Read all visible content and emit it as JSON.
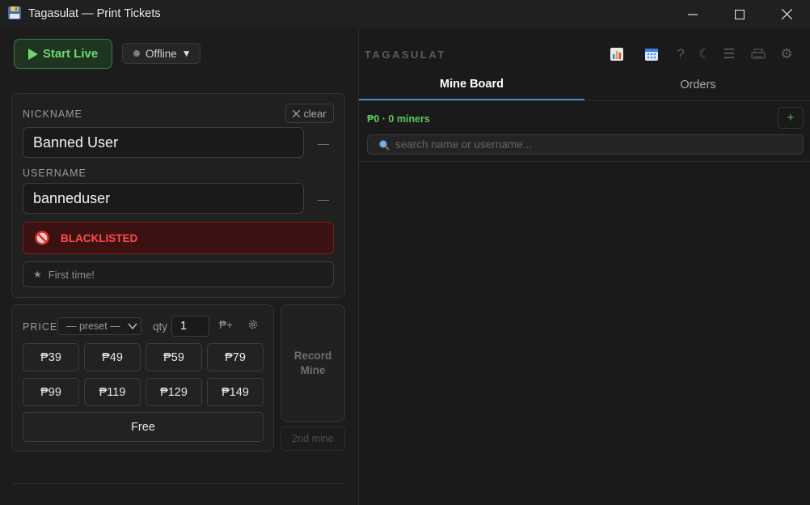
{
  "window": {
    "title": "Tagasulat — Print Tickets"
  },
  "controls": {
    "start_live_label": "Start Live",
    "status_label": "Offline"
  },
  "user": {
    "nickname_label": "NICKNAME",
    "clear_label": "clear",
    "nickname_value": "Banned User",
    "username_label": "USERNAME",
    "username_value": "banneduser",
    "dash": "—",
    "blacklist_label": "BLACKLISTED",
    "note": "First time!"
  },
  "pricing": {
    "price_label": "PRICE",
    "preset_placeholder": "— preset —",
    "qty_label": "qty",
    "qty_value": "1",
    "custom_label": "₱+",
    "prices": [
      "₱39",
      "₱49",
      "₱59",
      "₱79",
      "₱99",
      "₱119",
      "₱129",
      "₱149"
    ],
    "free_label": "Free"
  },
  "actions": {
    "record_label_line1": "Record",
    "record_label_line2": "Mine",
    "second_mine_label": "2nd mine"
  },
  "right": {
    "brand": "TAGASULAT",
    "tabs": [
      "Mine Board",
      "Orders"
    ],
    "summary": "₱0 · 0 miners",
    "add_label": "+",
    "search_placeholder": "search name or username..."
  },
  "colors": {
    "accent_green": "#5ec55e",
    "danger": "#ff4b4b",
    "tab_underline": "#3d8ed8"
  }
}
